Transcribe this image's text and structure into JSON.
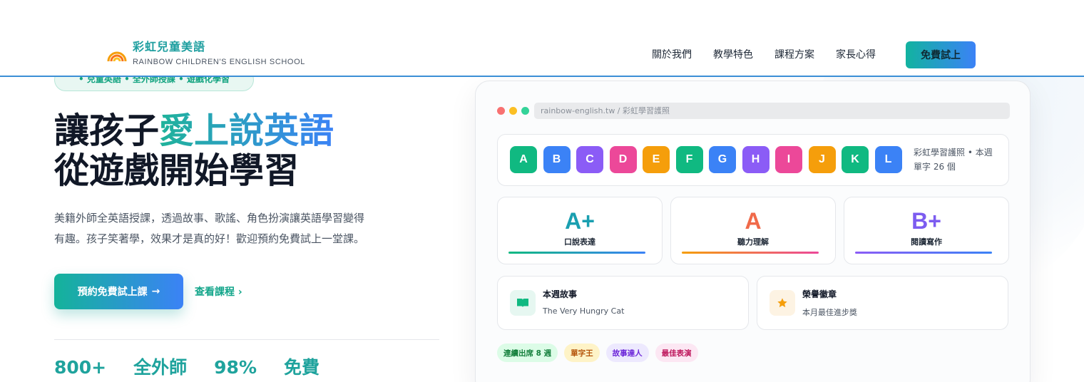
{
  "header": {
    "logo_title": "彩虹兒童美語",
    "logo_sub": "RAINBOW CHILDREN'S ENGLISH SCHOOL",
    "nav": [
      "關於我們",
      "教學特色",
      "課程方案",
      "家長心得"
    ],
    "cta": "免費試上"
  },
  "hero": {
    "tagline": "• 兒童英語 • 全外師授課 • 遊戲化學習",
    "headline_prefix": "讓孩子",
    "headline_accent": "愛上說英語",
    "headline_line2": "從遊戲開始學習",
    "desc_line1": "美籍外師全英語授課，透過故事、歌謠、角色扮演讓英語學習變得",
    "desc_line2": "有趣。孩子笑著學，效果才是真的好！歡迎預約免費試上一堂課。",
    "primary_button": "預約免費試上課",
    "primary_arrow": "→",
    "secondary_link": "查看課程 ›",
    "stats": [
      "800+",
      "全外師",
      "98%",
      "免費"
    ]
  },
  "window": {
    "url": "rainbow-english.tw / 彩虹學習護照",
    "letters": [
      {
        "ch": "A",
        "color": "#10b981"
      },
      {
        "ch": "B",
        "color": "#3b82f6"
      },
      {
        "ch": "C",
        "color": "#8b5cf6"
      },
      {
        "ch": "D",
        "color": "#ec4899"
      },
      {
        "ch": "E",
        "color": "#f59e0b"
      },
      {
        "ch": "F",
        "color": "#10b981"
      },
      {
        "ch": "G",
        "color": "#3b82f6"
      },
      {
        "ch": "H",
        "color": "#8b5cf6"
      },
      {
        "ch": "I",
        "color": "#ec4899"
      },
      {
        "ch": "J",
        "color": "#f59e0b"
      },
      {
        "ch": "K",
        "color": "#10b981"
      },
      {
        "ch": "L",
        "color": "#3b82f6"
      }
    ],
    "passport_note": "彩虹學習護照 • 本週單字 26 個",
    "grades": [
      {
        "grade": "A+",
        "label": "口說表達",
        "color": "#1a9fb0",
        "bar": "linear-gradient(90deg,#10b981,#3b82f6)"
      },
      {
        "grade": "A",
        "label": "聽力理解",
        "color": "#f06a4a",
        "bar": "linear-gradient(90deg,#f59e0b,#ec4899)"
      },
      {
        "grade": "B+",
        "label": "閱讀寫作",
        "color": "#7c5cf0",
        "bar": "linear-gradient(90deg,#8b5cf6,#3b82f6)"
      }
    ],
    "story_title": "本週故事",
    "story_sub": "The Very Hungry Cat",
    "honor_title": "榮譽徽章",
    "honor_sub": "本月最佳進步獎",
    "badges": [
      {
        "text": "連續出席 8 週",
        "bg": "#dcfce7",
        "fg": "#15803d"
      },
      {
        "text": "單字王",
        "bg": "#fef3c7",
        "fg": "#b45309"
      },
      {
        "text": "故事達人",
        "bg": "#ede9fe",
        "fg": "#6d28d9"
      },
      {
        "text": "最佳表演",
        "bg": "#fce7f3",
        "fg": "#be185d"
      }
    ]
  },
  "colors": {
    "brand": "#1fa39d",
    "accent_blue": "#3b82f6",
    "dot_red": "#f87171",
    "dot_yellow": "#fbbf24",
    "dot_green": "#34d399"
  }
}
